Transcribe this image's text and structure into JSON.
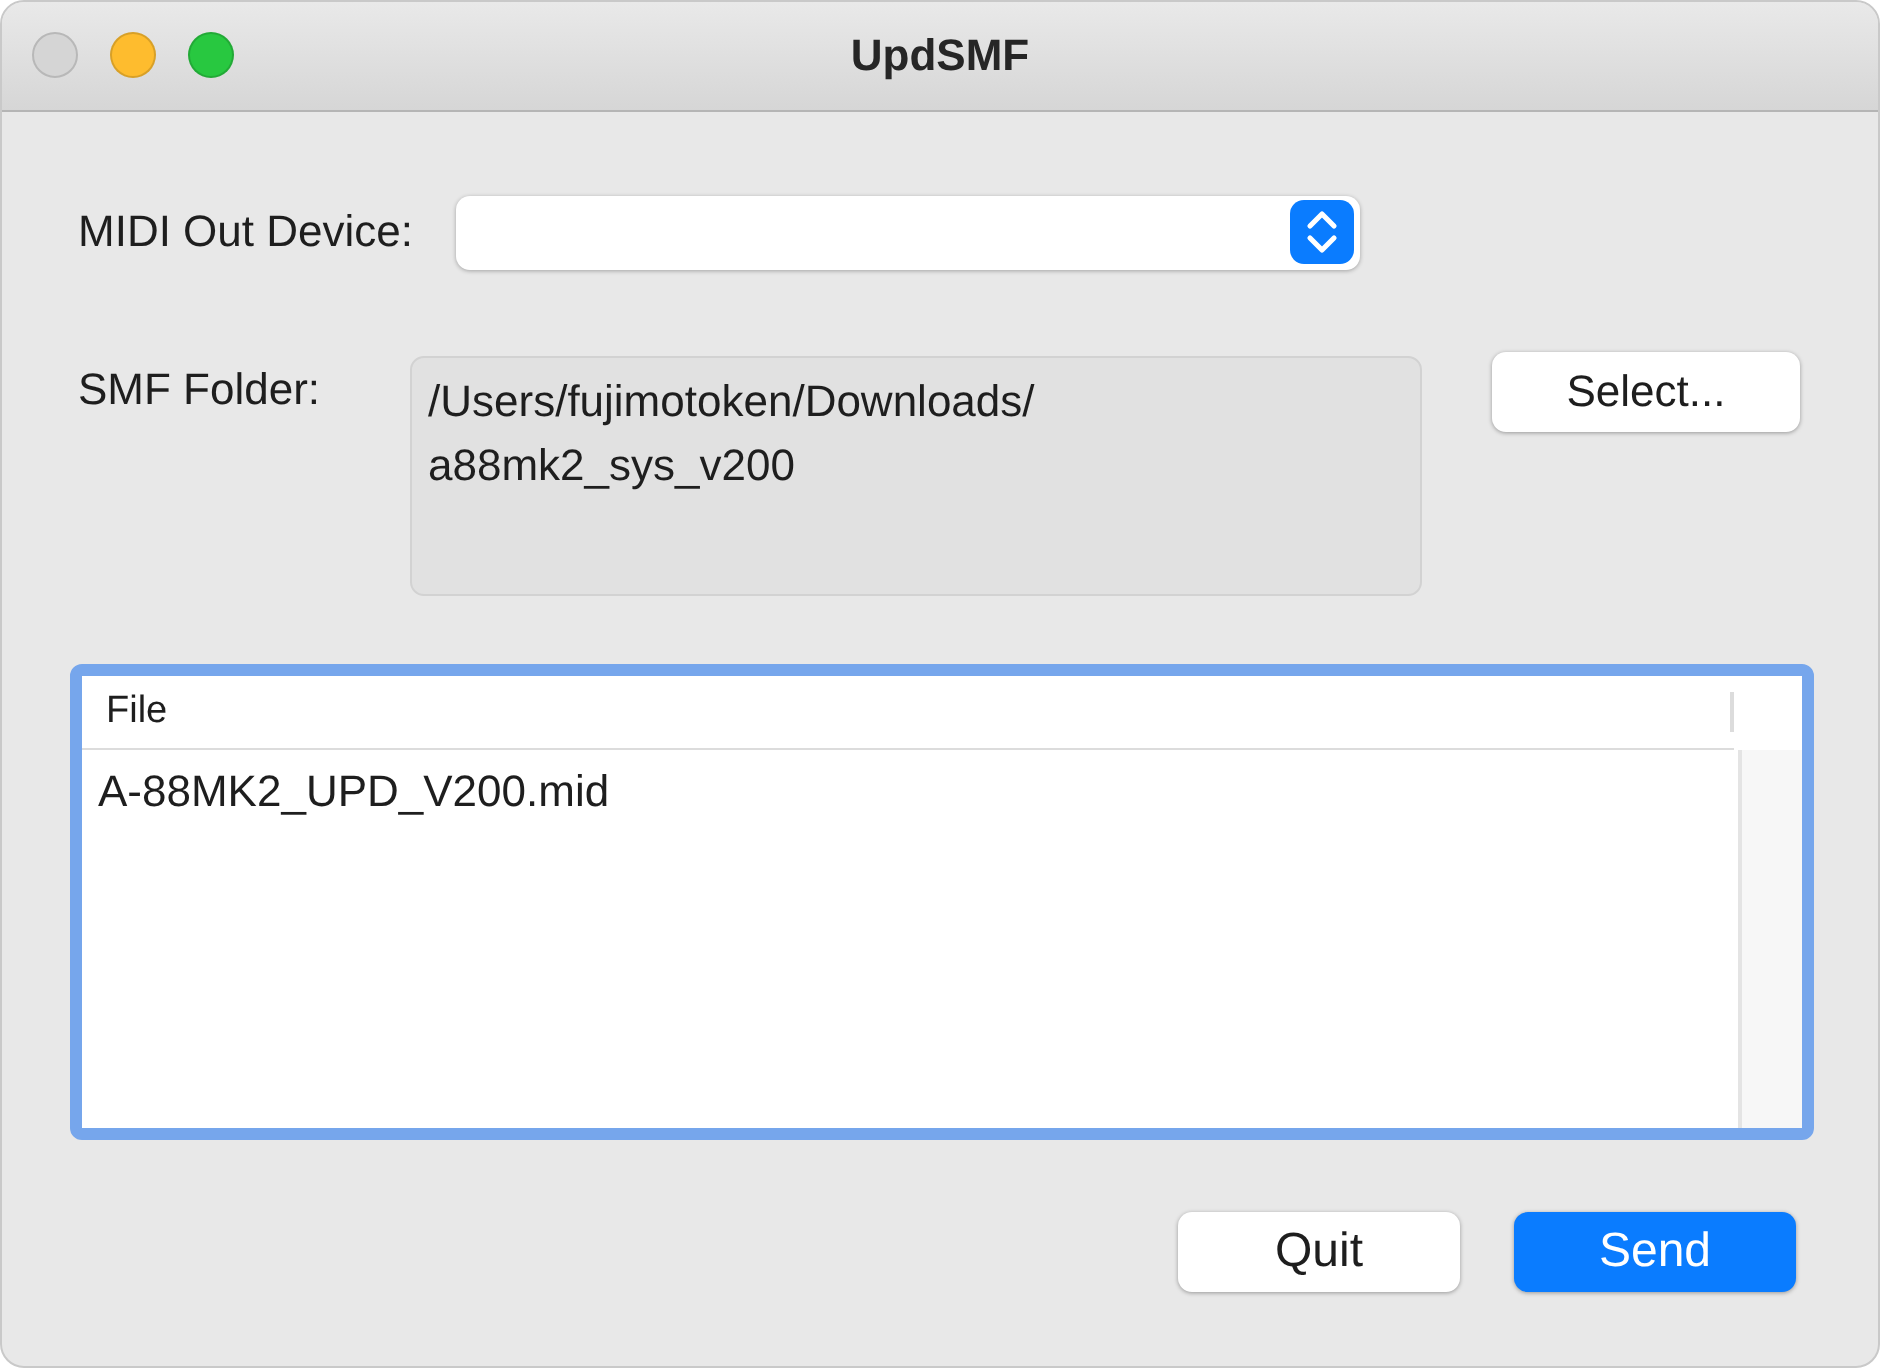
{
  "window": {
    "title": "UpdSMF",
    "controls": [
      {
        "kind": "close",
        "disabled": true
      },
      {
        "kind": "minimize",
        "disabled": false
      },
      {
        "kind": "zoom",
        "disabled": false
      }
    ]
  },
  "midi_out_device": {
    "label": "MIDI Out Device:"
  },
  "smf_folder": {
    "label": "SMF Folder:",
    "value": "/Users/fujimotoken/Downloads/a88mk2_sys_v200",
    "button": "Select..."
  },
  "file_table": {
    "focused": true,
    "columns": [
      "File"
    ],
    "rows": [
      {
        "file": "A-88MK2_UPD_V200.mid",
        "selected": false
      }
    ]
  },
  "buttons": [
    {
      "label": "Quit",
      "default": false
    },
    {
      "label": "Send",
      "default": true
    }
  ]
}
